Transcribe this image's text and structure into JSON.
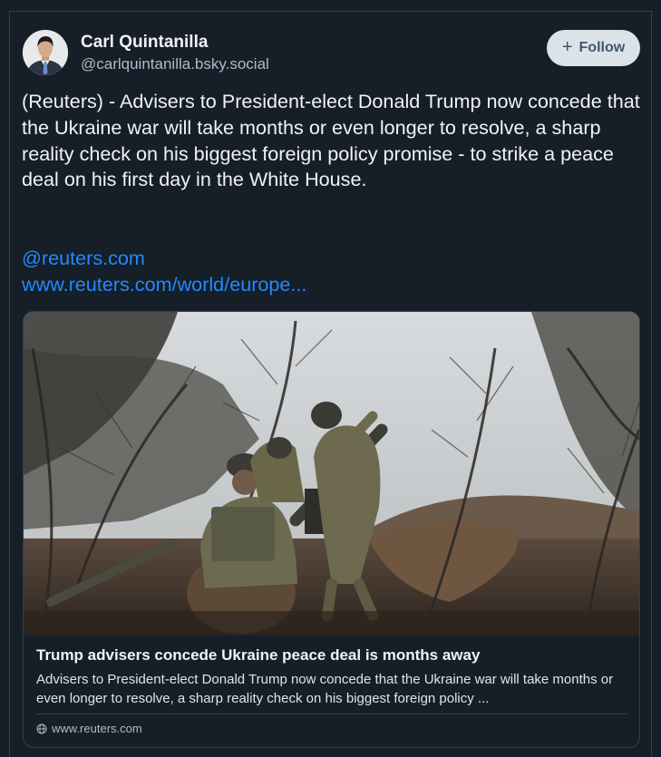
{
  "author": {
    "display_name": "Carl Quintanilla",
    "handle": "@carlquintanilla.bsky.social"
  },
  "follow_button": {
    "label": "Follow",
    "icon": "plus-icon"
  },
  "post": {
    "text": "(Reuters) - Advisers to President-elect Donald Trump now concede that the Ukraine war will take months or even longer to resolve, a sharp reality check on his biggest foreign policy promise - to strike a peace deal on his first day in the White House.",
    "mention": "@reuters.com",
    "url": "www.reuters.com/world/europe..."
  },
  "link_card": {
    "title": "Trump advisers concede Ukraine peace deal is months away",
    "description": "Advisers to President-elect Donald Trump now concede that the Ukraine war will take months or even longer to resolve, a sharp reality check on his biggest foreign policy ...",
    "domain": "www.reuters.com",
    "domain_icon": "globe-icon"
  },
  "colors": {
    "background": "#161e27",
    "border": "#2e4052",
    "text": "#f1f3f5",
    "secondary_text": "#aebbc9",
    "link": "#208bfe",
    "follow_button_bg": "#dce2ea",
    "follow_button_text": "#42576c"
  }
}
